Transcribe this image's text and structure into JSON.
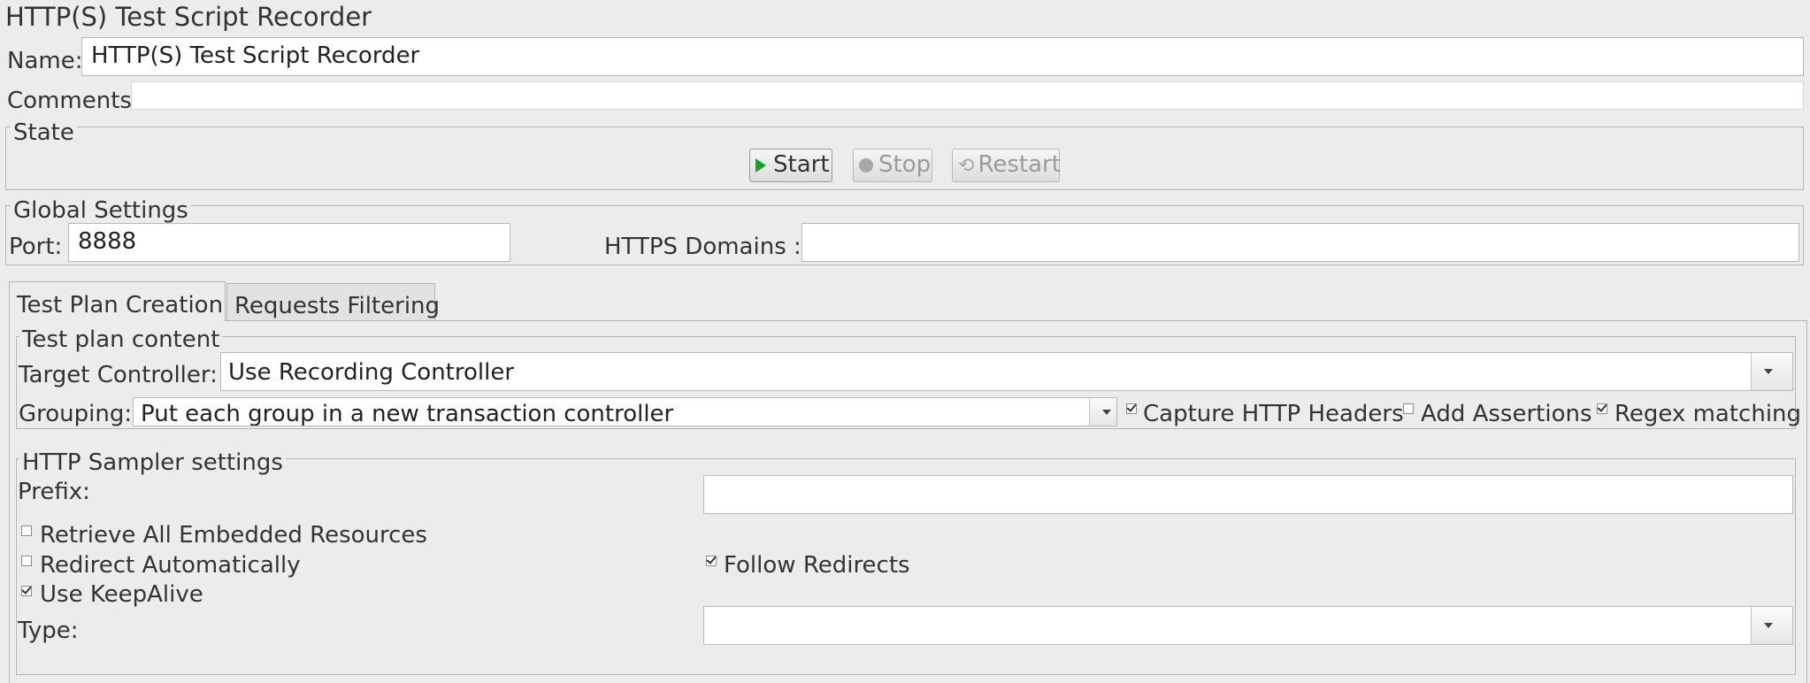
{
  "page": {
    "title": "HTTP(S) Test Script Recorder"
  },
  "name_field": {
    "label": "Name:",
    "value": "HTTP(S) Test Script Recorder"
  },
  "comments_field": {
    "label": "Comments:",
    "value": ""
  },
  "state": {
    "legend": "State",
    "start_label": "Start",
    "stop_label": "Stop",
    "restart_label": "Restart"
  },
  "global_settings": {
    "legend": "Global Settings",
    "port_label": "Port:",
    "port_value": "8888",
    "https_domains_label": "HTTPS Domains :",
    "https_domains_value": ""
  },
  "tabs": [
    {
      "label": "Test Plan Creation",
      "active": true
    },
    {
      "label": "Requests Filtering",
      "active": false
    }
  ],
  "test_plan_content": {
    "legend": "Test plan content",
    "target_controller_label": "Target Controller:",
    "target_controller_value": "Use Recording Controller",
    "grouping_label": "Grouping:",
    "grouping_value": "Put each group in a new transaction controller",
    "capture_headers": {
      "label": "Capture HTTP Headers",
      "checked": true
    },
    "add_assertions": {
      "label": "Add Assertions",
      "checked": false
    },
    "regex_matching": {
      "label": "Regex matching",
      "checked": true
    }
  },
  "http_sampler_settings": {
    "legend": "HTTP Sampler settings",
    "prefix_label": "Prefix:",
    "prefix_value": "",
    "retrieve_embedded": {
      "label": "Retrieve All Embedded Resources",
      "checked": false
    },
    "redirect_auto": {
      "label": "Redirect Automatically",
      "checked": false
    },
    "follow_redirects": {
      "label": "Follow Redirects",
      "checked": true
    },
    "use_keepalive": {
      "label": "Use KeepAlive",
      "checked": true
    },
    "type_label": "Type:",
    "type_value": ""
  },
  "colors": {
    "background": "#ececec",
    "start_icon": "#1f9e2a"
  }
}
